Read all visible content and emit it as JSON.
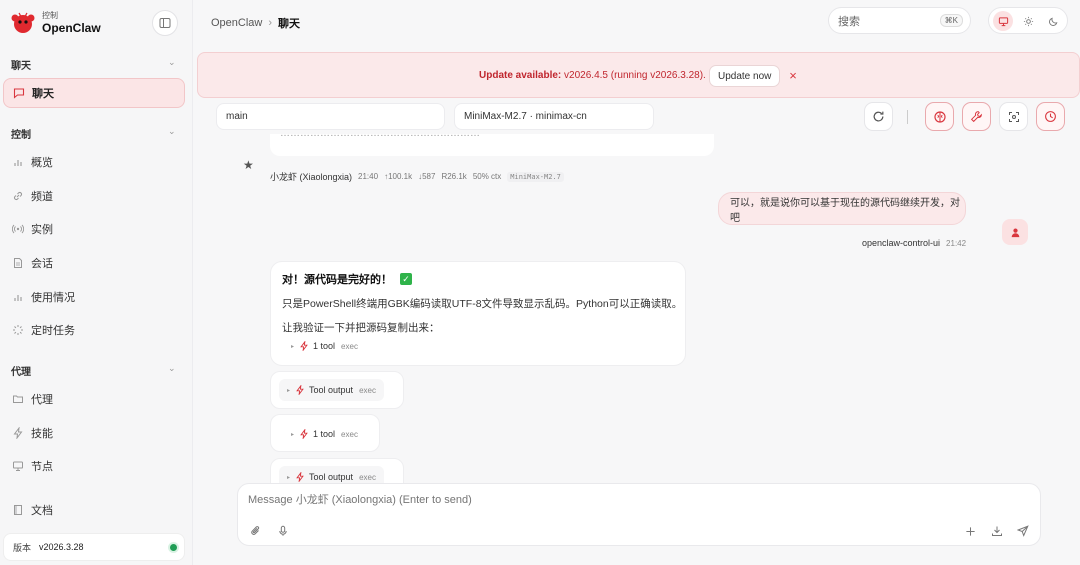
{
  "brand": {
    "sub": "控制",
    "name": "OpenClaw"
  },
  "sidebar": {
    "sections": [
      {
        "label": "聊天",
        "items": [
          {
            "label": "聊天",
            "icon": "chat-icon",
            "active": true
          }
        ]
      },
      {
        "label": "控制",
        "items": [
          {
            "label": "概览",
            "icon": "bar-chart-icon"
          },
          {
            "label": "频道",
            "icon": "link-icon"
          },
          {
            "label": "实例",
            "icon": "radio-icon"
          },
          {
            "label": "会话",
            "icon": "document-icon"
          },
          {
            "label": "使用情况",
            "icon": "bar-chart-icon"
          },
          {
            "label": "定时任务",
            "icon": "loader-icon"
          }
        ]
      },
      {
        "label": "代理",
        "items": [
          {
            "label": "代理",
            "icon": "folder-icon"
          },
          {
            "label": "技能",
            "icon": "bolt-icon"
          },
          {
            "label": "节点",
            "icon": "monitor-icon"
          }
        ]
      }
    ],
    "docs_label": "文档",
    "version_label": "版本",
    "version_value": "v2026.3.28",
    "status_color": "#1f9d55"
  },
  "topbar": {
    "breadcrumb_root": "OpenClaw",
    "breadcrumb_sep": "›",
    "breadcrumb_current": "聊天",
    "search_placeholder": "搜索",
    "search_shortcut": "⌘K"
  },
  "banner": {
    "title": "Update available:",
    "detail": " v2026.4.5 (running v2026.3.28).",
    "button": "Update now",
    "close": "×"
  },
  "selectors": {
    "session": "main",
    "model": "MiniMax-M2.7 · minimax-cn"
  },
  "chat": {
    "clipped_text": "……………………………………………………",
    "assistant_meta": {
      "sender": "小龙虾 (Xiaolongxia)",
      "time": "21:40",
      "up": "↑100.1k",
      "down": "↓587",
      "r": "R26.1k",
      "ctx": "50% ctx",
      "model": "MiniMax-M2.7"
    },
    "user_message": "可以，就是说你可以基于现在的源代码继续开发，对吧",
    "user_meta": {
      "name": "openclaw-control-ui",
      "time": "21:42"
    },
    "ai_reply": {
      "title": "对！源代码是完好的！",
      "check": "✓",
      "p1": "只是PowerShell终端用GBK编码读取UTF-8文件导致显示乱码。Python可以正确读取。",
      "p2": "让我验证一下并把源码复制出来："
    },
    "tool_rows": [
      {
        "label": "1 tool",
        "tag": "exec"
      },
      {
        "label": "Tool output",
        "tag": "exec"
      },
      {
        "label": "1 tool",
        "tag": "exec"
      },
      {
        "label": "Tool output",
        "tag": "exec"
      }
    ]
  },
  "composer": {
    "placeholder": "Message 小龙虾 (Xiaolongxia) (Enter to send)"
  },
  "colors": {
    "accent": "#d9363e",
    "banner_bg": "#fbe9ea"
  }
}
